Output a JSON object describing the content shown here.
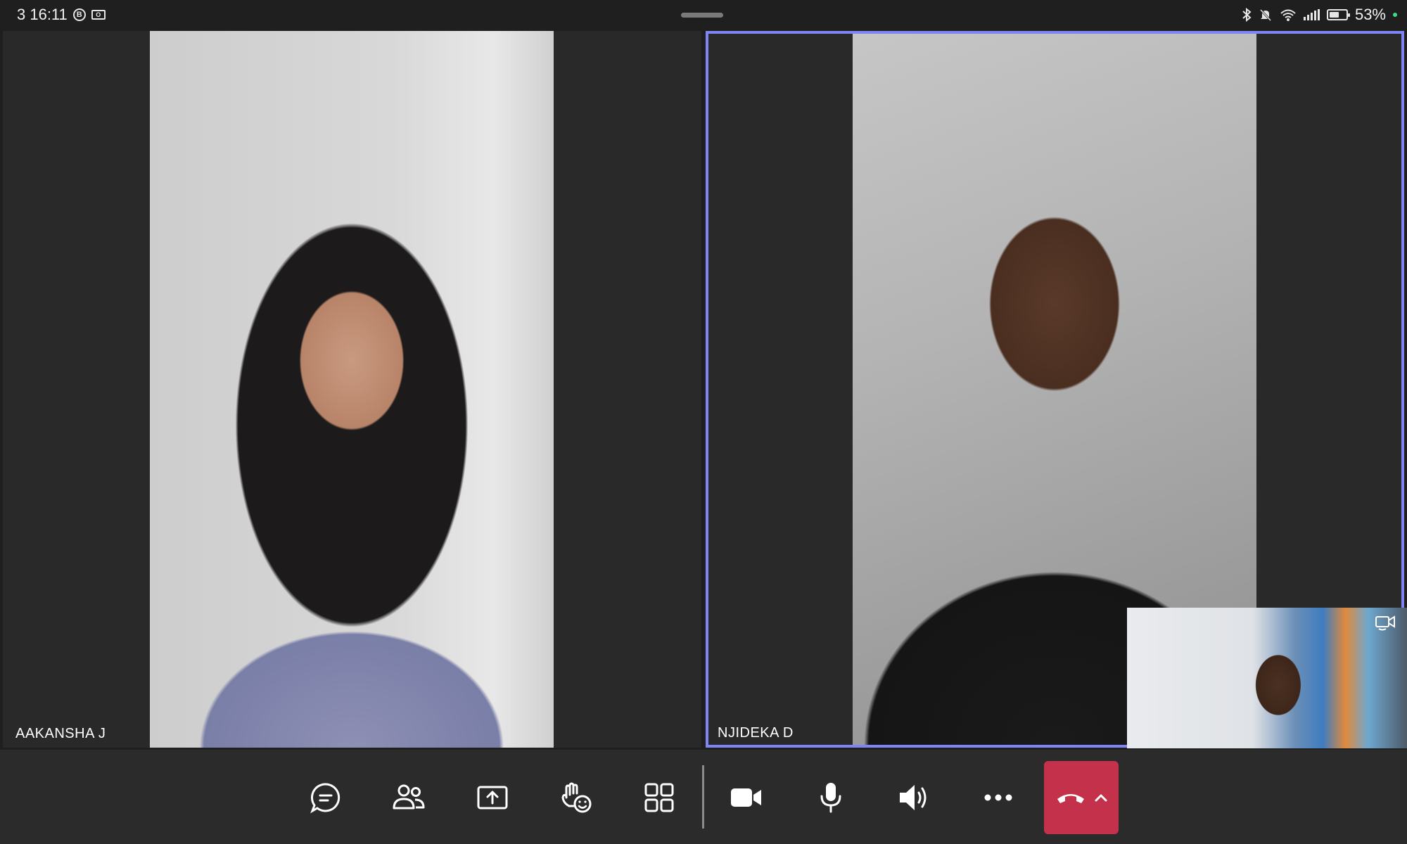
{
  "status_bar": {
    "time": "3 16:11",
    "battery": "53%",
    "notification_icons": [
      "b-icon",
      "outlook-icon"
    ],
    "system_icons": [
      "bluetooth-icon",
      "mute-bell-icon",
      "wifi-icon",
      "signal-icon",
      "battery-icon"
    ]
  },
  "participants": [
    {
      "name": "AAKANSHA J",
      "active_speaker": false
    },
    {
      "name": "NJIDEKA D",
      "active_speaker": true
    }
  ],
  "self_view": {
    "switch_camera_icon": "switch-camera-icon"
  },
  "controls": {
    "buttons": [
      "chat-icon",
      "people-icon",
      "share-icon",
      "react-icon",
      "layout-icon",
      "camera-icon",
      "mic-icon",
      "speaker-icon",
      "more-icon"
    ],
    "end_call": {
      "icon": "hang-up-icon",
      "chevron": "chevron-up-icon"
    }
  },
  "colors": {
    "active_border": "#7f85f5",
    "end_call": "#c4314b",
    "background": "#1f1f1f",
    "control_bar": "#2b2b2b"
  }
}
